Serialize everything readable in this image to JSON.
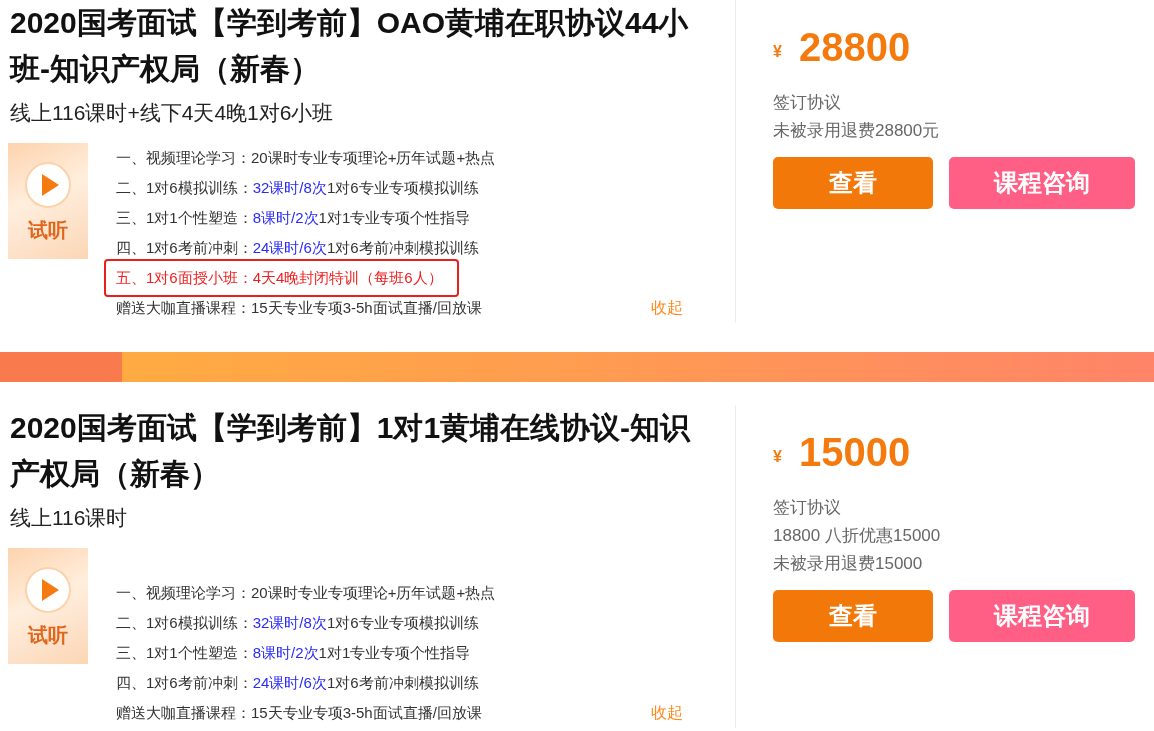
{
  "courses": [
    {
      "title": "2020国考面试【学到考前】OAO黄埔在职协议44小班-知识产权局（新春）",
      "subtitle": "线上116课时+线下4天4晚1对6小班",
      "trial_label": "试听",
      "outline": [
        {
          "highlighted": false,
          "segments": [
            {
              "text": "一、视频理论学习：20课时专业专项理论+历年试题+热点",
              "emphasis": false
            }
          ]
        },
        {
          "highlighted": false,
          "segments": [
            {
              "text": "二、1对6模拟训练：",
              "emphasis": false
            },
            {
              "text": "32课时/8次",
              "emphasis": true
            },
            {
              "text": "1对6专业专项模拟训练",
              "emphasis": false
            }
          ]
        },
        {
          "highlighted": false,
          "segments": [
            {
              "text": "三、1对1个性塑造：",
              "emphasis": false
            },
            {
              "text": "8课时/2次",
              "emphasis": true
            },
            {
              "text": "1对1专业专项个性指导",
              "emphasis": false
            }
          ]
        },
        {
          "highlighted": false,
          "segments": [
            {
              "text": "四、1对6考前冲刺：",
              "emphasis": false
            },
            {
              "text": "24课时/6次",
              "emphasis": true
            },
            {
              "text": "1对6考前冲刺模拟训练",
              "emphasis": false
            }
          ]
        },
        {
          "highlighted": true,
          "segments": [
            {
              "text": "五、1对6面授小班：4天4晚封闭特训（每班6人）",
              "emphasis": false
            }
          ]
        }
      ],
      "bonus": "赠送大咖直播课程：15天专业专项3-5h面试直播/回放课",
      "collapse_link": "收起",
      "currency": "¥",
      "price": "28800",
      "notes": [
        "签订协议",
        "未被录用退费28800元"
      ],
      "buttons": [
        {
          "kind": "view",
          "label": "查看"
        },
        {
          "kind": "consult",
          "label": "课程咨询"
        }
      ]
    },
    {
      "title": "2020国考面试【学到考前】1对1黄埔在线协议-知识产权局（新春）",
      "subtitle": "线上116课时",
      "trial_label": "试听",
      "outline": [
        {
          "highlighted": false,
          "segments": [
            {
              "text": "一、视频理论学习：20课时专业专项理论+历年试题+热点",
              "emphasis": false
            }
          ]
        },
        {
          "highlighted": false,
          "segments": [
            {
              "text": "二、1对6模拟训练：",
              "emphasis": false
            },
            {
              "text": "32课时/8次",
              "emphasis": true
            },
            {
              "text": "1对6专业专项模拟训练",
              "emphasis": false
            }
          ]
        },
        {
          "highlighted": false,
          "segments": [
            {
              "text": "三、1对1个性塑造：",
              "emphasis": false
            },
            {
              "text": "8课时/2次",
              "emphasis": true
            },
            {
              "text": "1对1专业专项个性指导",
              "emphasis": false
            }
          ]
        },
        {
          "highlighted": false,
          "segments": [
            {
              "text": "四、1对6考前冲刺：",
              "emphasis": false
            },
            {
              "text": "24课时/6次",
              "emphasis": true
            },
            {
              "text": "1对6考前冲刺模拟训练",
              "emphasis": false
            }
          ]
        }
      ],
      "bonus": "赠送大咖直播课程：15天专业专项3-5h面试直播/回放课",
      "collapse_link": "收起",
      "currency": "¥",
      "price": "15000",
      "notes": [
        "签订协议",
        "18800 八折优惠15000",
        "未被录用退费15000"
      ],
      "buttons": [
        {
          "kind": "view",
          "label": "查看"
        },
        {
          "kind": "consult",
          "label": "课程咨询"
        }
      ]
    }
  ]
}
